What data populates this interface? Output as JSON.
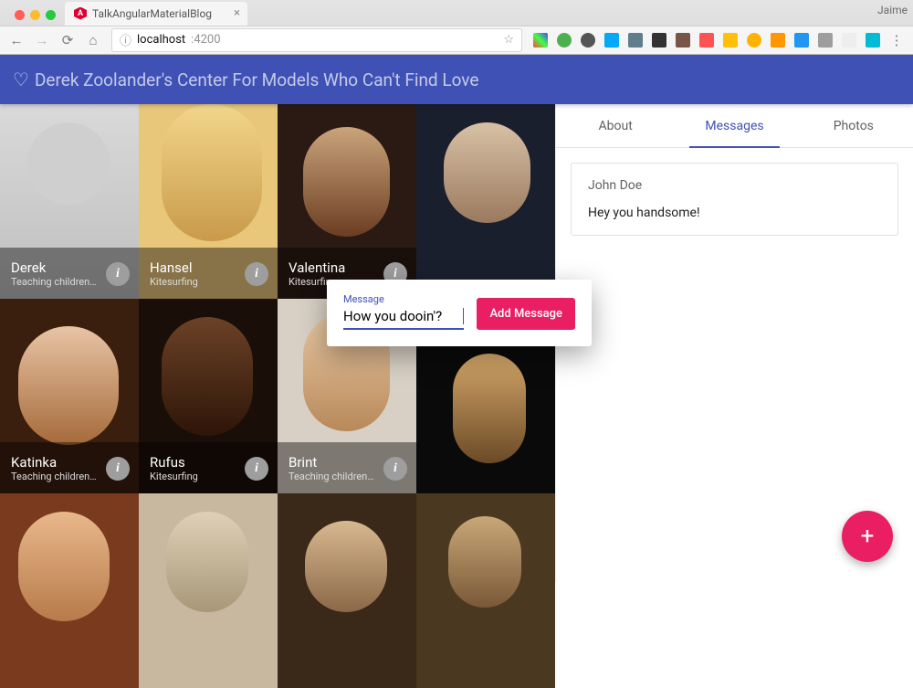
{
  "browser": {
    "tab_title": "TalkAngularMaterialBlog",
    "user_label": "Jaime",
    "url_host": "localhost",
    "url_port": ":4200",
    "info_glyph": "ⓘ",
    "star_glyph": "☆"
  },
  "app": {
    "title": "Derek Zoolander's Center For Models Who Can't Find Love"
  },
  "models": [
    {
      "name": "Derek",
      "subtitle": "Teaching children…"
    },
    {
      "name": "Hansel",
      "subtitle": "Kitesurfing"
    },
    {
      "name": "Valentina",
      "subtitle": "Kitesurfing"
    },
    {
      "name": "",
      "subtitle": ""
    },
    {
      "name": "Katinka",
      "subtitle": "Teaching children…"
    },
    {
      "name": "Rufus",
      "subtitle": "Kitesurfing"
    },
    {
      "name": "Brint",
      "subtitle": "Teaching children…"
    },
    {
      "name": "",
      "subtitle": ""
    },
    {
      "name": "",
      "subtitle": ""
    },
    {
      "name": "",
      "subtitle": ""
    },
    {
      "name": "",
      "subtitle": ""
    },
    {
      "name": "",
      "subtitle": ""
    }
  ],
  "tabs": {
    "about": "About",
    "messages": "Messages",
    "photos": "Photos",
    "active": "messages"
  },
  "message": {
    "from": "John Doe",
    "body": "Hey you handsome!"
  },
  "dialog": {
    "field_label": "Message",
    "input_value": "How you dooin'?",
    "button_label": "Add Message"
  },
  "fab": {
    "glyph": "+"
  },
  "info_glyph": "i",
  "colors": {
    "primary": "#3f51b5",
    "accent": "#e91e63"
  }
}
